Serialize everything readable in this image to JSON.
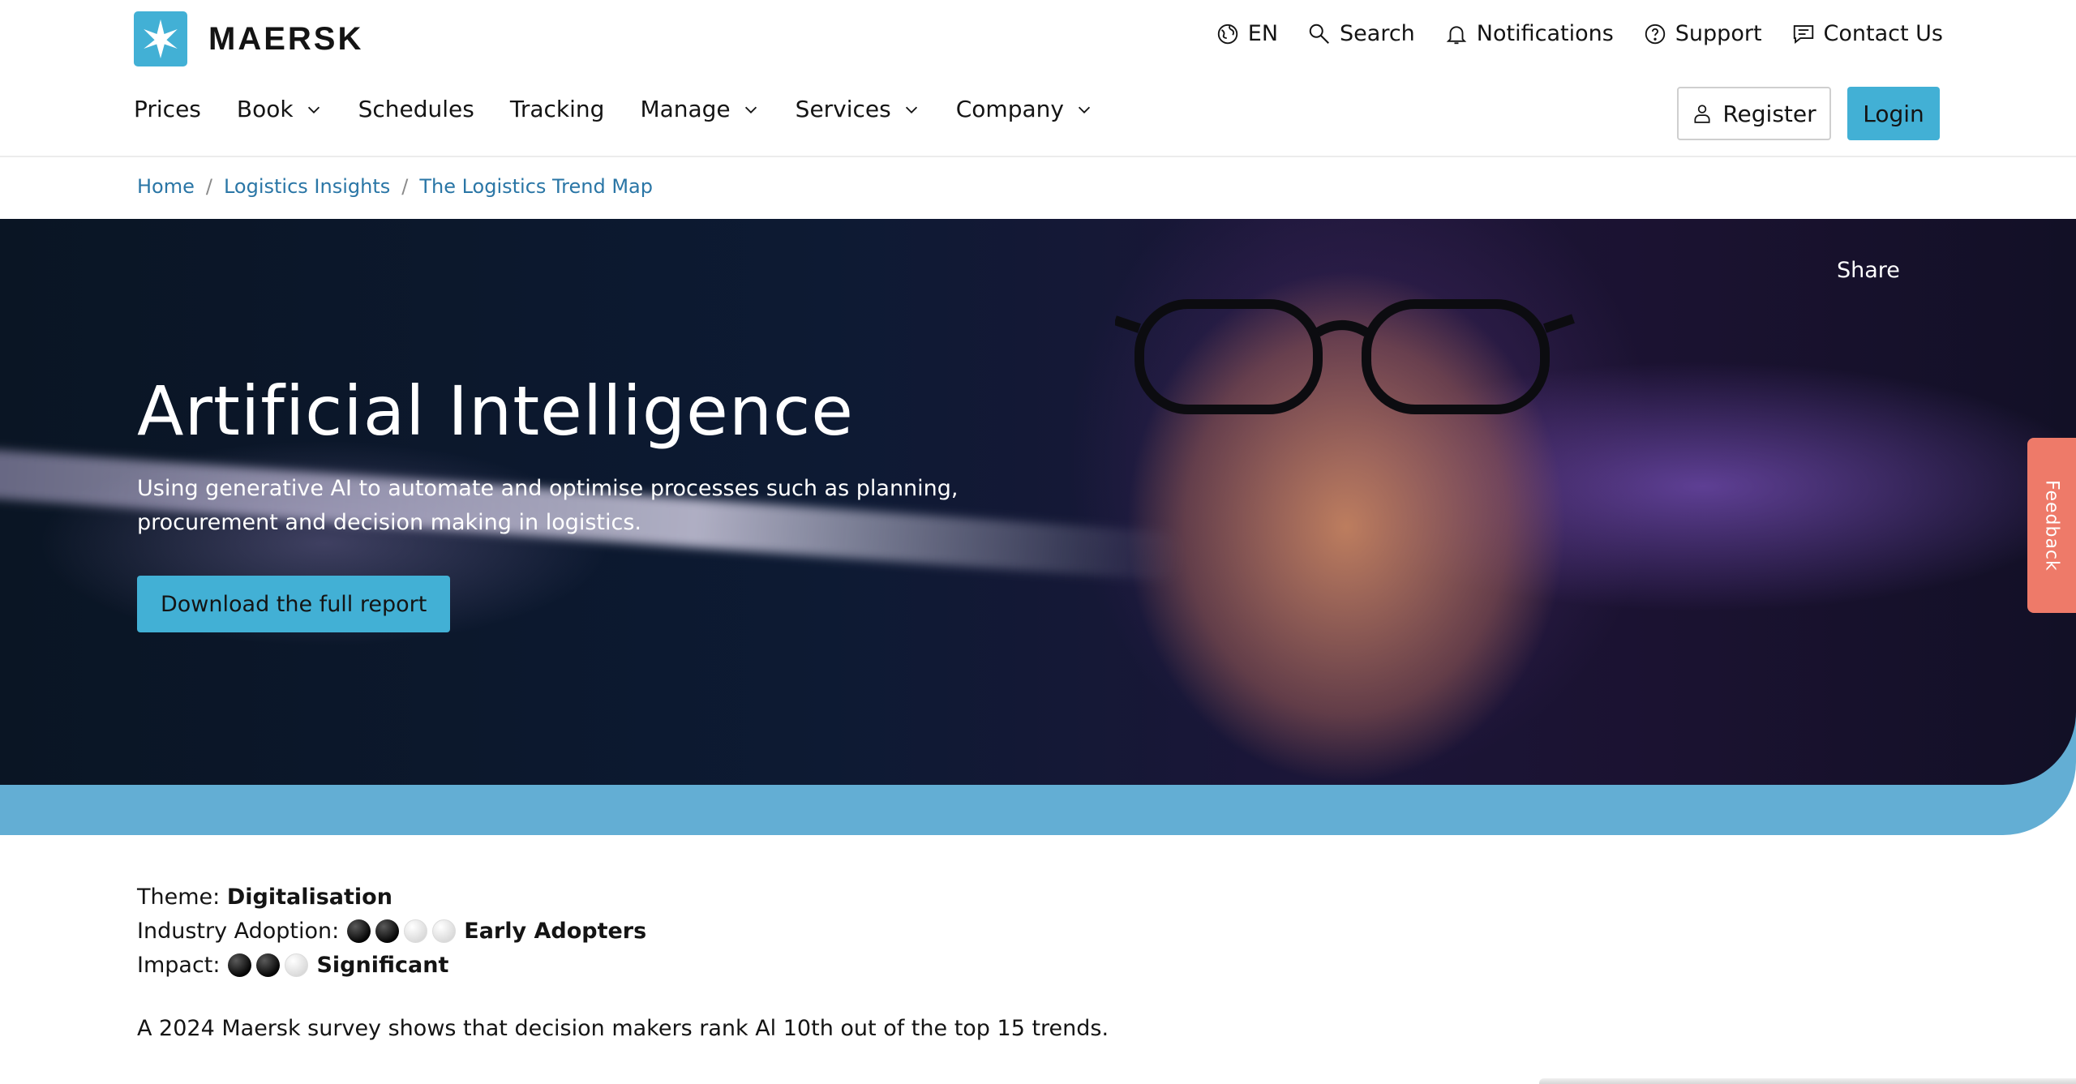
{
  "brand": {
    "name": "MAERSK",
    "accent": "#42b0d5"
  },
  "utility_nav": [
    {
      "label": "EN",
      "icon": "globe-icon"
    },
    {
      "label": "Search",
      "icon": "search-icon"
    },
    {
      "label": "Notifications",
      "icon": "bell-icon"
    },
    {
      "label": "Support",
      "icon": "help-circle-icon"
    },
    {
      "label": "Contact Us",
      "icon": "chat-icon"
    }
  ],
  "main_nav": [
    {
      "label": "Prices"
    },
    {
      "label": "Book",
      "dropdown": true
    },
    {
      "label": "Schedules"
    },
    {
      "label": "Tracking"
    },
    {
      "label": "Manage",
      "dropdown": true
    },
    {
      "label": "Services",
      "dropdown": true
    },
    {
      "label": "Company",
      "dropdown": true
    }
  ],
  "auth": {
    "register_label": "Register",
    "login_label": "Login"
  },
  "breadcrumb": [
    "Home",
    "Logistics Insights",
    "The Logistics Trend Map"
  ],
  "hero": {
    "share_label": "Share",
    "title": "Artificial Intelligence",
    "description": "Using generative AI to automate and optimise processes such as planning, procurement and decision making in logistics.",
    "cta_label": "Download the full report",
    "band_color": "#63aed4"
  },
  "feedback_label": "Feedback",
  "details": {
    "theme_label": "Theme:",
    "theme_value": "Digitalisation",
    "adoption_label": "Industry Adoption:",
    "adoption_level": 2,
    "adoption_max": 4,
    "adoption_value": "Early Adopters",
    "impact_label": "Impact:",
    "impact_level": 2,
    "impact_max": 3,
    "impact_value": "Significant"
  },
  "survey_text": "A 2024 Maersk survey shows that decision makers rank Al 10th out of the top 15 trends."
}
